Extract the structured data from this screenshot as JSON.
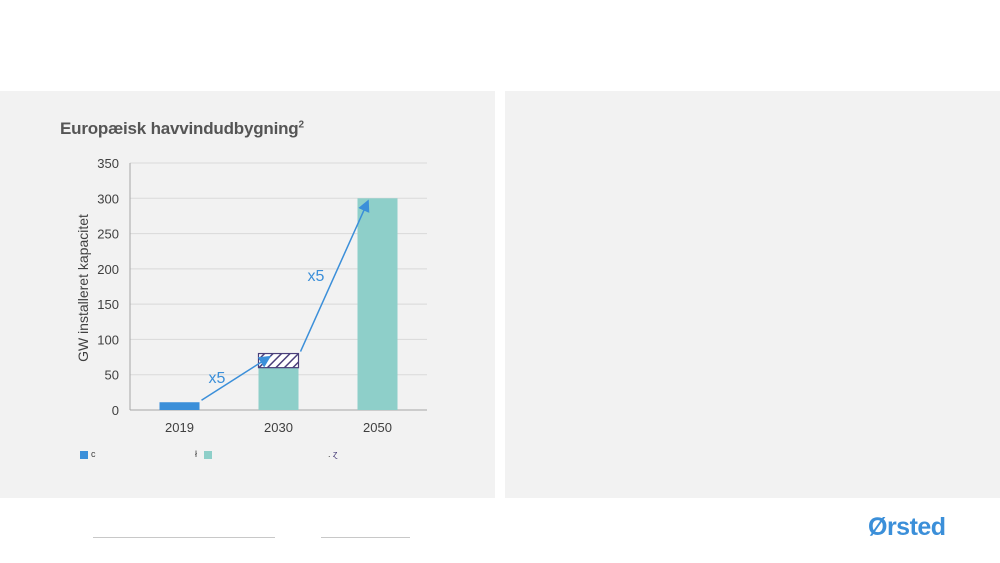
{
  "chart_data": {
    "type": "bar",
    "title": "Europæisk havvindudbygning",
    "title_superscript": "2",
    "ylabel": "GW installeret kapacitet",
    "xlabel": "",
    "ylim": [
      0,
      350
    ],
    "yticks": [
      "0",
      "50",
      "100",
      "150",
      "200",
      "250",
      "300",
      "350"
    ],
    "categories": [
      "2019",
      "2030",
      "2050"
    ],
    "series": [
      {
        "values": [
          11,
          0,
          0
        ],
        "color": "#3b8fd9"
      },
      {
        "values": [
          0,
          60,
          300
        ],
        "color": "#8ecfc9"
      },
      {
        "values": [
          0,
          20,
          0
        ],
        "pattern": "hatched"
      }
    ],
    "annotations": [
      "x5",
      "x5"
    ],
    "grid": true,
    "legend_position": "bottom",
    "legend": [
      "c",
      "",
      "ɀ"
    ]
  },
  "colors": {
    "accent_blue": "#3b8fd9",
    "teal": "#8ecfc9",
    "hatch": "#4a3f7a",
    "panel_bg": "#f2f2f2"
  },
  "branding": {
    "logo_text": "Ørsted"
  }
}
